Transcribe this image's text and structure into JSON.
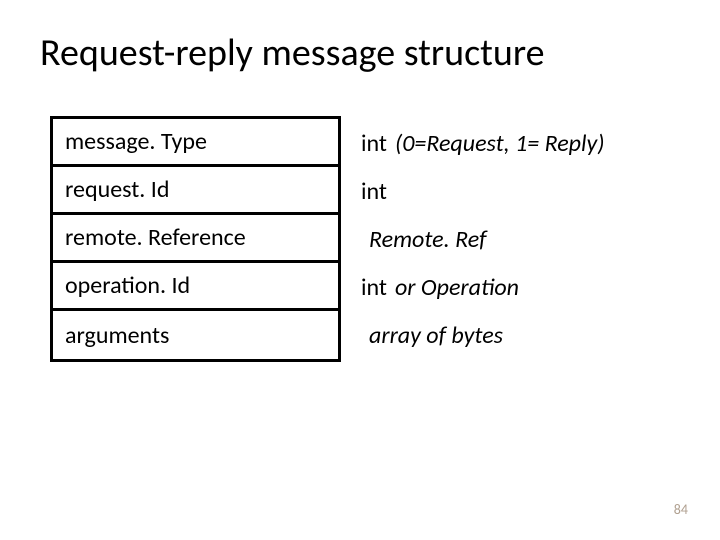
{
  "title": "Request-reply message structure",
  "rows": [
    {
      "field": "message. Type",
      "type_prefix": "int",
      "type_rest": "(0=Request, 1= Reply)"
    },
    {
      "field": "request. Id",
      "type_prefix": "int",
      "type_rest": ""
    },
    {
      "field": "remote. Reference",
      "type_prefix": "",
      "type_rest": "Remote. Ref"
    },
    {
      "field": "operation. Id",
      "type_prefix": "int",
      "type_rest": " or Operation"
    },
    {
      "field": "arguments",
      "type_prefix": "",
      "type_rest": "array of bytes"
    }
  ],
  "page_number": "84"
}
